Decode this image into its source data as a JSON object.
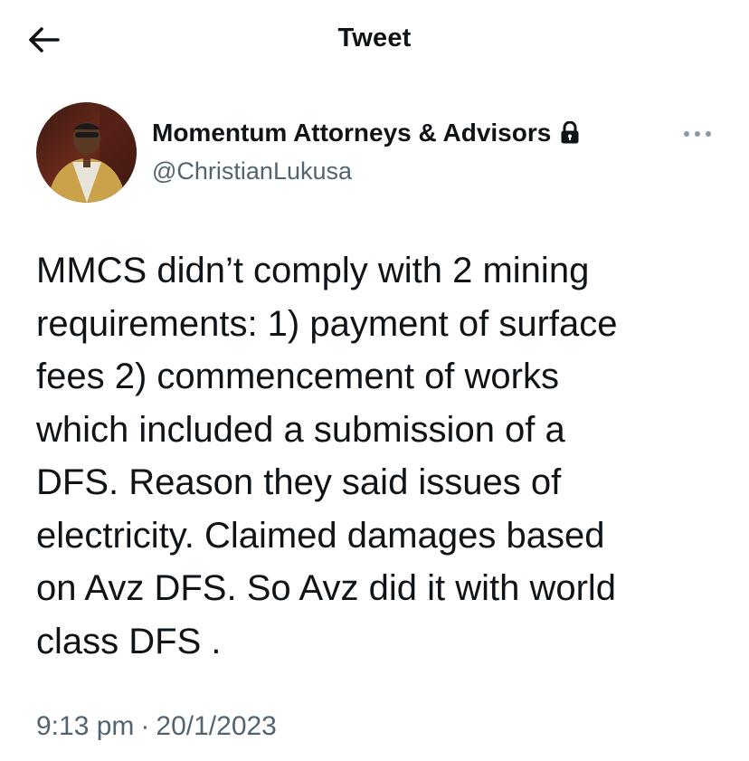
{
  "header": {
    "title": "Tweet",
    "back_icon": "arrow-left-icon"
  },
  "author": {
    "display_name": "Momentum Attorneys & Advisors",
    "handle": "@ChristianLukusa",
    "protected_icon": "lock-icon",
    "avatar_icon": "profile-photo"
  },
  "more_icon": "more-horizontal-icon",
  "tweet": {
    "text": "MMCS didn’t comply with 2 mining\nrequirements: 1) payment of surface\nfees 2) commencement of works\nwhich included a submission of a\nDFS. Reason they said issues of\nelectricity. Claimed damages based\non Avz DFS. So Avz did it with world\nclass DFS ."
  },
  "meta": {
    "time": "9:13 pm",
    "separator": "·",
    "date": "20/1/2023"
  },
  "colors": {
    "text_primary": "#0f1419",
    "text_secondary": "#536471",
    "background": "#ffffff"
  }
}
